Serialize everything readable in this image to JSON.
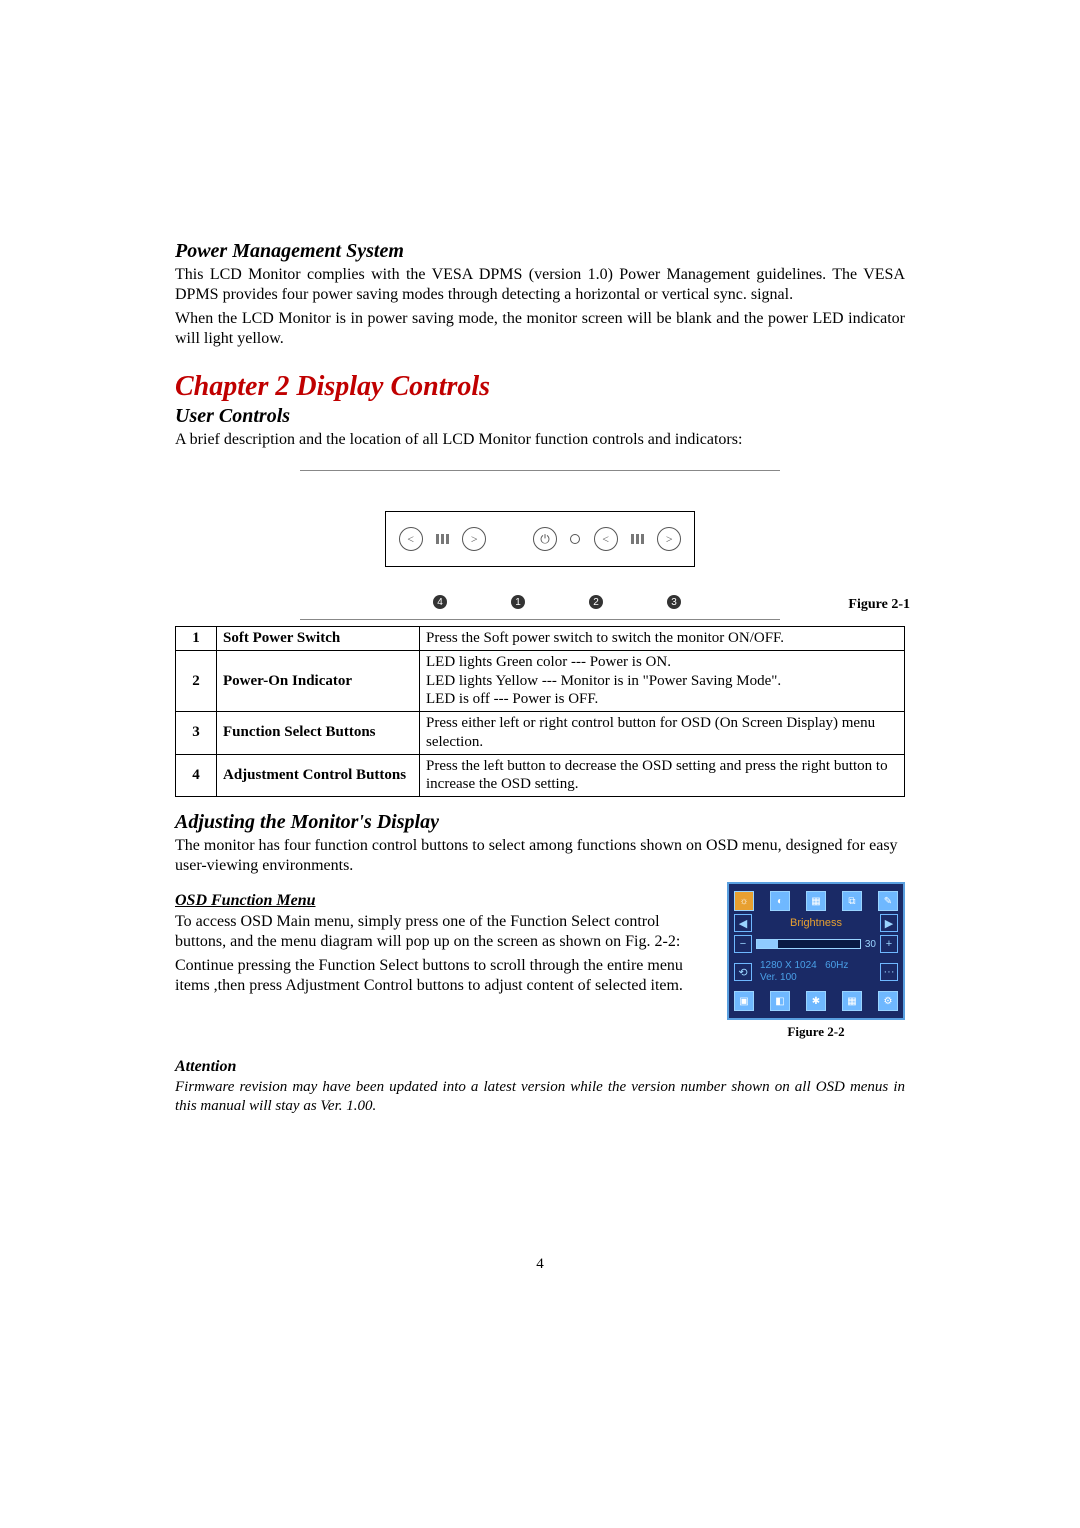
{
  "section1": {
    "heading": "Power Management System",
    "p1": "This LCD Monitor complies with the VESA DPMS (version 1.0) Power Management guidelines. The VESA DPMS provides four power saving modes through detecting a horizontal or vertical sync. signal.",
    "p2": "When the LCD Monitor is in power saving mode, the monitor screen will be blank and the power LED indicator will light yellow."
  },
  "chapter": "Chapter 2 Display Controls",
  "section2": {
    "heading": "User Controls",
    "p": "A brief description and the location of all LCD Monitor function controls and indicators:"
  },
  "figure21": {
    "caption": "Figure 2-1",
    "markers": [
      "4",
      "1",
      "2",
      "3"
    ]
  },
  "controls_table": [
    {
      "num": "1",
      "name": "Soft Power Switch",
      "desc": "Press the Soft power switch to switch the monitor ON/OFF."
    },
    {
      "num": "2",
      "name": "Power-On Indicator",
      "desc": "LED lights Green color --- Power is ON.\nLED lights Yellow --- Monitor is in \"Power Saving Mode\".\nLED is off --- Power is OFF."
    },
    {
      "num": "3",
      "name": "Function Select Buttons",
      "desc": "Press either left or right control button for OSD (On Screen Display) menu selection."
    },
    {
      "num": "4",
      "name": "Adjustment Control Buttons",
      "desc": "Press the left button to decrease the OSD setting and press the right button to increase the OSD setting."
    }
  ],
  "section3": {
    "heading": "Adjusting the Monitor's Display",
    "p": "The monitor has four function control buttons to select among functions shown on OSD menu, designed for easy user-viewing environments."
  },
  "osd": {
    "heading": "OSD Function Menu  ",
    "p1": "To access OSD Main menu, simply press one of the Function Select control buttons, and the menu diagram will pop up on the screen as shown on Fig. 2-2:",
    "p2": "Continue pressing the Function Select buttons to scroll through the entire menu items ,then press Adjustment Control buttons to adjust content of selected item.",
    "panel": {
      "label": "Brightness",
      "value": "30",
      "resolution": "1280 X 1024",
      "hz": "60Hz",
      "ver": "Ver. 100"
    },
    "caption": "Figure 2-2"
  },
  "attention": {
    "heading": "Attention",
    "body": "Firmware revision may have been updated into a latest version while the version number shown on all OSD menus in this manual will stay as Ver. 1.00."
  },
  "page_number": "4"
}
